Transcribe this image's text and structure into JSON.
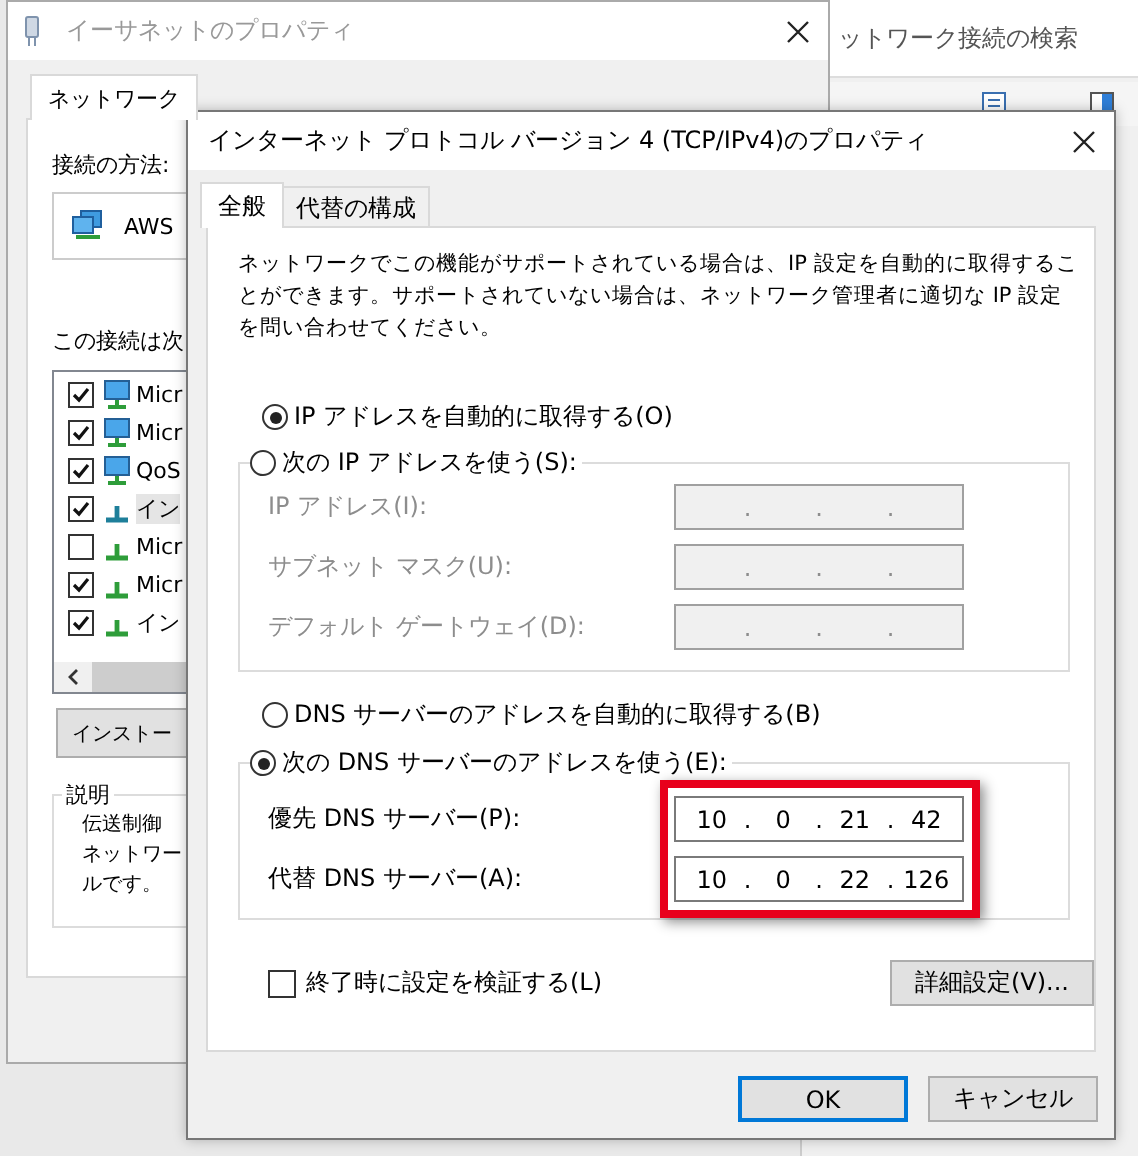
{
  "explorer": {
    "search": {
      "placeholder": "ットワーク接続の検索"
    }
  },
  "back_window": {
    "title": "イーサネットのプロパティ",
    "active": false,
    "tabs": [
      {
        "label": "ネットワーク",
        "selected": true
      }
    ],
    "connect_label": "接続の方法:",
    "adapter": "AWS",
    "items_label": "この接続は次",
    "items": [
      {
        "label": "Micr",
        "checked": true,
        "kind": "client",
        "selected": false
      },
      {
        "label": "Micr",
        "checked": true,
        "kind": "client",
        "selected": false
      },
      {
        "label": "QoS",
        "checked": true,
        "kind": "client",
        "selected": false
      },
      {
        "label": "イン",
        "checked": true,
        "kind": "protocol",
        "selected": true
      },
      {
        "label": "Micr",
        "checked": false,
        "kind": "protocol",
        "selected": false
      },
      {
        "label": "Micr",
        "checked": true,
        "kind": "protocol",
        "selected": false
      },
      {
        "label": "イン",
        "checked": true,
        "kind": "protocol",
        "selected": false
      }
    ],
    "install_button": "インストー",
    "description": {
      "legend": "説明",
      "lines": [
        "伝送制御",
        "ネットワー",
        "ルです。"
      ]
    }
  },
  "dialog": {
    "title": "インターネット プロトコル バージョン 4 (TCP/IPv4)のプロパティ",
    "active": true,
    "tabs": [
      {
        "label": "全般",
        "selected": true
      },
      {
        "label": "代替の構成",
        "selected": false
      }
    ],
    "intro": "ネットワークでこの機能がサポートされている場合は、IP 設定を自動的に取得することができます。サポートされていない場合は、ネットワーク管理者に適切な IP 設定を問い合わせてください。",
    "separator": ".",
    "ip_modes": [
      {
        "label": "IP アドレスを自動的に取得する(O)",
        "selected": true
      },
      {
        "label": "次の IP アドレスを使う(S):",
        "selected": false
      }
    ],
    "ip_fields": [
      {
        "label": "IP アドレス(I):",
        "disabled": true
      },
      {
        "label": "サブネット マスク(U):",
        "disabled": true
      },
      {
        "label": "デフォルト ゲートウェイ(D):",
        "disabled": true
      }
    ],
    "dns_modes": [
      {
        "label": "DNS サーバーのアドレスを自動的に取得する(B)",
        "selected": false
      },
      {
        "label": "次の DNS サーバーのアドレスを使う(E):",
        "selected": true
      }
    ],
    "dns_fields": [
      {
        "label": "優先 DNS サーバー(P):",
        "disabled": false,
        "octets": [
          "10",
          "0",
          "21",
          "42"
        ]
      },
      {
        "label": "代替 DNS サーバー(A):",
        "disabled": false,
        "octets": [
          "10",
          "0",
          "22",
          "126"
        ]
      }
    ],
    "dns_highlighted": true,
    "validate": {
      "label": "終了時に設定を検証する(L)",
      "checked": false
    },
    "advanced_button": "詳細設定(V)...",
    "buttons": [
      {
        "label": "OK",
        "default": true
      },
      {
        "label": "キャンセル",
        "default": false
      }
    ]
  }
}
